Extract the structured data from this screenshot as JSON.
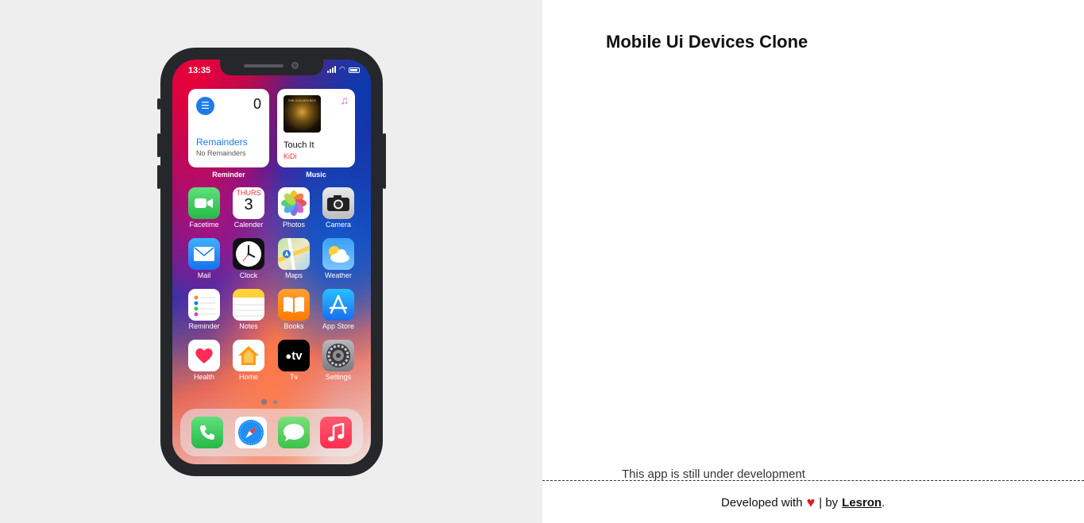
{
  "phone": {
    "status_time": "13:35",
    "widgets": {
      "reminder": {
        "count": "0",
        "title": "Remainders",
        "subtitle": "No Remainders",
        "label": "Reminder"
      },
      "music": {
        "album_text": "THE GOLDEN BOY",
        "song": "Touch It",
        "artist": "KiDi",
        "label": "Music"
      }
    },
    "calendar": {
      "weekday": "THURS",
      "day": "3"
    },
    "apps": [
      {
        "name": "Facetime",
        "icon": "facetime-icon",
        "color": "#34c759"
      },
      {
        "name": "Calender",
        "icon": "calendar-icon",
        "color": "#ffffff"
      },
      {
        "name": "Photos",
        "icon": "photos-icon",
        "color": "#ffffff"
      },
      {
        "name": "Camera",
        "icon": "camera-icon",
        "color": "#d8d8dc"
      },
      {
        "name": "Mail",
        "icon": "mail-icon",
        "color": "#1f8ef5"
      },
      {
        "name": "Clock",
        "icon": "clock-icon",
        "color": "#000000"
      },
      {
        "name": "Maps",
        "icon": "maps-icon",
        "color": "#8fd36a"
      },
      {
        "name": "Weather",
        "icon": "weather-icon",
        "color": "#3ba1f5"
      },
      {
        "name": "Reminder",
        "icon": "reminder-icon",
        "color": "#ffffff"
      },
      {
        "name": "Notes",
        "icon": "notes-icon",
        "color": "#ffffff"
      },
      {
        "name": "Books",
        "icon": "books-icon",
        "color": "#ff8c1a"
      },
      {
        "name": "App Store",
        "icon": "app-store-icon",
        "color": "#1a8cf5"
      },
      {
        "name": "Health",
        "icon": "health-icon",
        "color": "#ffffff"
      },
      {
        "name": "Home",
        "icon": "home-icon",
        "color": "#ffffff"
      },
      {
        "name": "Tv",
        "icon": "tv-icon",
        "color": "#000000"
      },
      {
        "name": "Settings",
        "icon": "settings-icon",
        "color": "#8e8e93"
      }
    ],
    "tv_text": "tv",
    "dock": [
      {
        "icon": "phone-icon",
        "color": "#34c759"
      },
      {
        "icon": "safari-icon",
        "color": "#ffffff"
      },
      {
        "icon": "messages-icon",
        "color": "#5ad45a"
      },
      {
        "icon": "music-icon",
        "color": "#ff2d55"
      }
    ]
  },
  "page": {
    "title": "Mobile Ui Devices Clone",
    "dev_note": "This app is still under development",
    "footer_prefix": "Developed with",
    "footer_by": "| by",
    "author": "Lesron",
    "footer_suffix": "."
  }
}
